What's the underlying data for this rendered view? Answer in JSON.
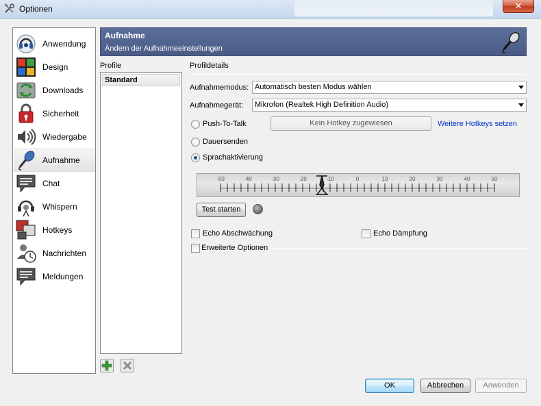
{
  "window": {
    "title": "Optionen",
    "close_label": "✕"
  },
  "sidebar": {
    "items": [
      {
        "label": "Anwendung",
        "icon": "teamspeak-icon",
        "selected": false
      },
      {
        "label": "Design",
        "icon": "design-palette-icon",
        "selected": false
      },
      {
        "label": "Downloads",
        "icon": "downloads-icon",
        "selected": false
      },
      {
        "label": "Sicherheit",
        "icon": "lock-icon",
        "selected": false
      },
      {
        "label": "Wiedergabe",
        "icon": "speaker-icon",
        "selected": false
      },
      {
        "label": "Aufnahme",
        "icon": "microphone-icon",
        "selected": true
      },
      {
        "label": "Chat",
        "icon": "chat-icon",
        "selected": false
      },
      {
        "label": "Whispern",
        "icon": "headset-icon",
        "selected": false
      },
      {
        "label": "Hotkeys",
        "icon": "hotkeys-icon",
        "selected": false
      },
      {
        "label": "Nachrichten",
        "icon": "messages-icon",
        "selected": false
      },
      {
        "label": "Meldungen",
        "icon": "notifications-icon",
        "selected": false
      }
    ]
  },
  "banner": {
    "title": "Aufnahme",
    "subtitle": "Ändern der Aufnahmeeinstellungen"
  },
  "profiles": {
    "header": "Profile",
    "items": [
      "Standard"
    ]
  },
  "details": {
    "header": "Profildetails",
    "mode_label": "Aufnahmemodus:",
    "mode_value": "Automatisch besten Modus wählen",
    "device_label": "Aufnahmegerät:",
    "device_value": "Mikrofon (Realtek High Definition Audio)",
    "ptt_label": "Push-To-Talk",
    "hotkey_button": "Kein Hotkey zugewiesen",
    "more_hotkeys_link": "Weitere Hotkeys setzen",
    "continuous_label": "Dauersenden",
    "voice_activation_label": "Sprachaktivierung",
    "selected_mode": "Sprachaktivierung",
    "slider": {
      "ticks": [
        "-50",
        "-40",
        "-30",
        "-20",
        "-10",
        "0",
        "10",
        "20",
        "30",
        "40",
        "50"
      ],
      "min": -50,
      "max": 50,
      "value": -13
    },
    "test_button": "Test starten",
    "echo_reduction_label": "Echo Abschwächung",
    "echo_cancellation_label": "Echo Dämpfung",
    "advanced_label": "Erweiterte Optionen"
  },
  "footer": {
    "ok": "OK",
    "cancel": "Abbrechen",
    "apply": "Anwenden"
  },
  "colors": {
    "banner": "#4f6190",
    "link": "#0033cc",
    "window": "#f0f0f0"
  }
}
